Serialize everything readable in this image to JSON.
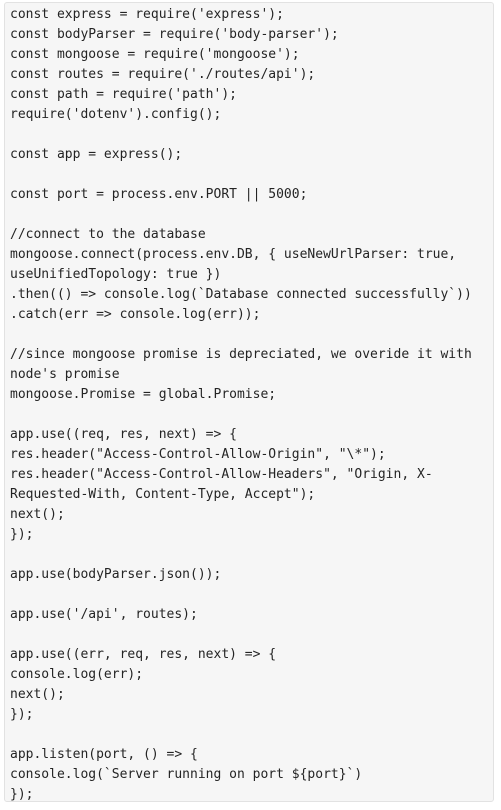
{
  "code": {
    "lines": [
      "const express = require('express');",
      "const bodyParser = require('body-parser');",
      "const mongoose = require('mongoose');",
      "const routes = require('./routes/api');",
      "const path = require('path');",
      "require('dotenv').config();",
      "",
      "const app = express();",
      "",
      "const port = process.env.PORT || 5000;",
      "",
      "//connect to the database",
      "mongoose.connect(process.env.DB, { useNewUrlParser: true,",
      "useUnifiedTopology: true })",
      ".then(() => console.log(`Database connected successfully`))",
      ".catch(err => console.log(err));",
      "",
      "//since mongoose promise is depreciated, we overide it with",
      "node's promise",
      "mongoose.Promise = global.Promise;",
      "",
      "app.use((req, res, next) => {",
      "res.header(\"Access-Control-Allow-Origin\", \"\\*\");",
      "res.header(\"Access-Control-Allow-Headers\", \"Origin, X-",
      "Requested-With, Content-Type, Accept\");",
      "next();",
      "});",
      "",
      "app.use(bodyParser.json());",
      "",
      "app.use('/api', routes);",
      "",
      "app.use((err, req, res, next) => {",
      "console.log(err);",
      "next();",
      "});",
      "",
      "app.listen(port, () => {",
      "console.log(`Server running on port ${port}`)",
      "});"
    ]
  }
}
